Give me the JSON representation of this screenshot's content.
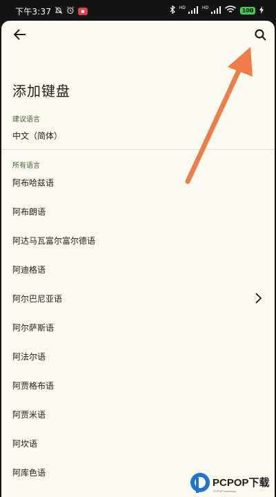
{
  "status_bar": {
    "time": "下午3:37",
    "battery": "100",
    "hd_labels": [
      "HD",
      "HD"
    ]
  },
  "header": {
    "title": "添加键盘"
  },
  "sections": {
    "suggested": {
      "label": "建议语言",
      "items": [
        {
          "label": "中文（简体）"
        }
      ]
    },
    "all": {
      "label": "所有语言",
      "items": [
        {
          "label": "阿布哈兹语"
        },
        {
          "label": "阿布朗语"
        },
        {
          "label": "阿达马瓦富尔富尔德语"
        },
        {
          "label": "阿迪格语"
        },
        {
          "label": "阿尔巴尼亚语",
          "has_submenu": true
        },
        {
          "label": "阿尔萨斯语"
        },
        {
          "label": "阿法尔语"
        },
        {
          "label": "阿贾格布语"
        },
        {
          "label": "阿贾米语"
        },
        {
          "label": "阿坎语"
        },
        {
          "label": "阿库色语"
        }
      ]
    }
  },
  "watermark": {
    "brand": "PCPOP下载"
  },
  "colors": {
    "sheet_background": "#fdfbf1",
    "section_label": "#3f5d2e",
    "annotation_arrow": "#f07c45"
  }
}
